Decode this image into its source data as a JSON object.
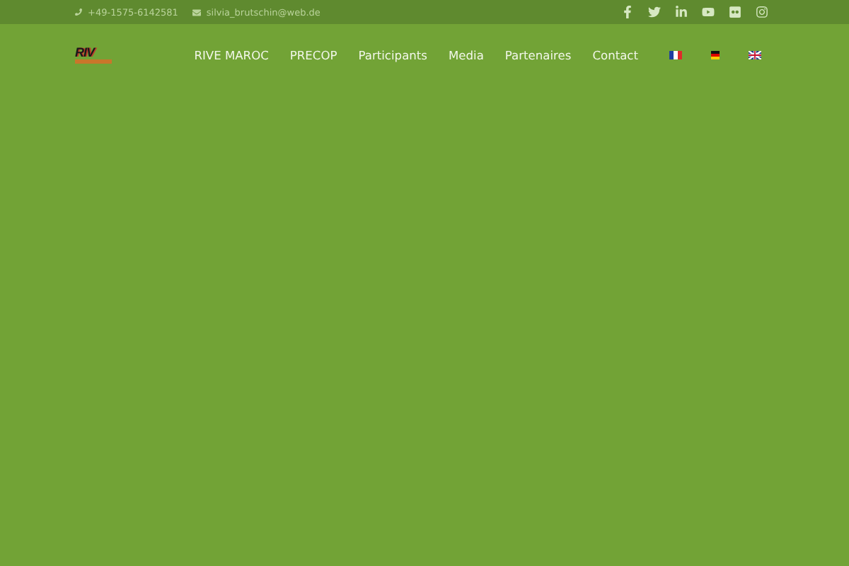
{
  "top_bar": {
    "phone": "+49-1575-6142581",
    "email": "silvia_brutschin@web.de",
    "social": [
      {
        "kind": "facebook"
      },
      {
        "kind": "twitter"
      },
      {
        "kind": "linkedin"
      },
      {
        "kind": "youtube"
      },
      {
        "kind": "flickr"
      },
      {
        "kind": "instagram"
      }
    ]
  },
  "header": {
    "logo": "RIV",
    "nav": [
      "RIVE MAROC",
      "PRECOP",
      "Participants",
      "Media",
      "Partenaires",
      "Contact"
    ],
    "languages": [
      {
        "kind": "fr"
      },
      {
        "kind": "de"
      },
      {
        "kind": "gb"
      }
    ]
  }
}
